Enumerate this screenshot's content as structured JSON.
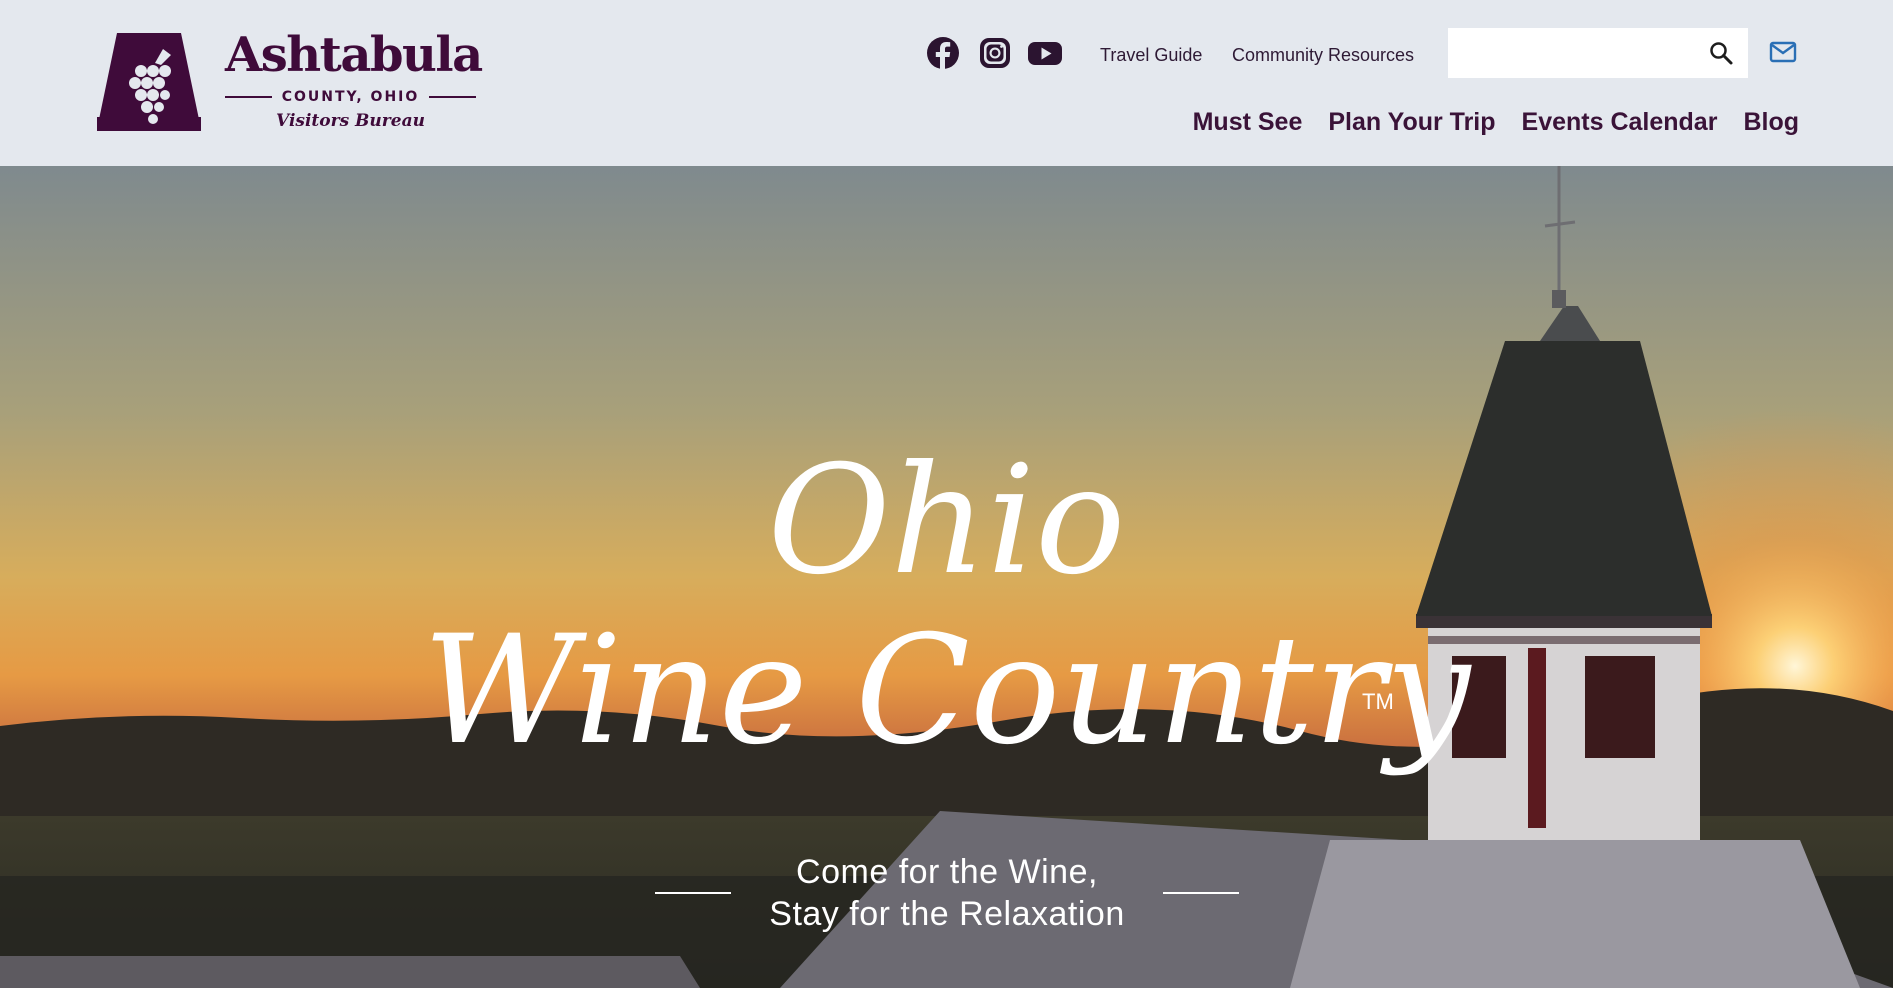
{
  "brand": {
    "name": "Ashtabula",
    "sub": "COUNTY, OHIO",
    "tagline": "Visitors Bureau",
    "color": "#3f0b3a"
  },
  "social": [
    {
      "name": "facebook-icon"
    },
    {
      "name": "instagram-icon"
    },
    {
      "name": "youtube-icon"
    }
  ],
  "utility_nav": {
    "travel_guide": "Travel Guide",
    "community_resources": "Community Resources"
  },
  "search": {
    "value": "",
    "placeholder": ""
  },
  "main_nav": {
    "must_see": "Must See",
    "plan_your_trip": "Plan Your Trip",
    "events_calendar": "Events Calendar",
    "blog": "Blog"
  },
  "hero": {
    "title_line1": "Ohio",
    "title_line2": "Wine Country",
    "trademark": "TM",
    "subtitle_line1": "Come for the Wine,",
    "subtitle_line2": "Stay for the Relaxation"
  },
  "colors": {
    "header_bg": "#e4e8ee",
    "nav_text": "#3a1338",
    "mail_icon": "#2a6fb5"
  }
}
